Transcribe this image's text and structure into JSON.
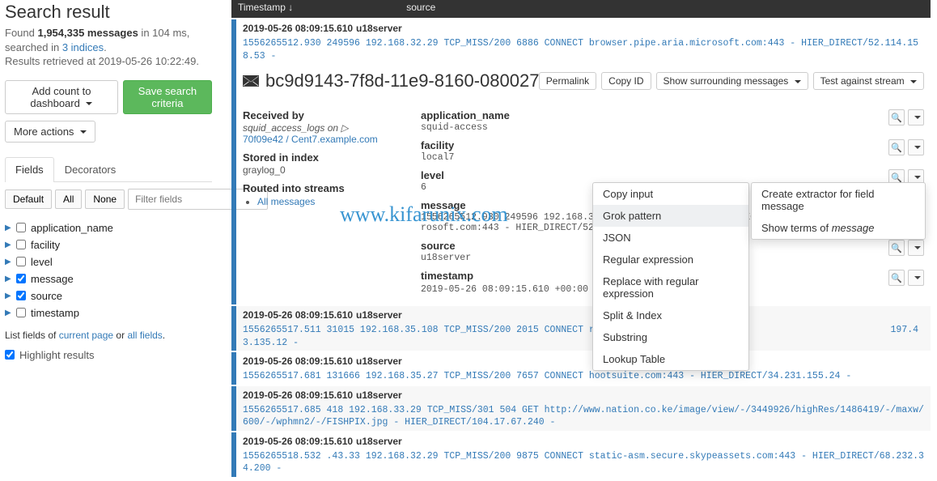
{
  "sidebar": {
    "title": "Search result",
    "found_prefix": "Found ",
    "msg_count": "1,954,335 messages",
    "found_suffix": " in 104 ms, searched in ",
    "indices_link": "3 indices",
    "retrieved": "Results retrieved at 2019-05-26 10:22:49.",
    "add_dashboard": "Add count to dashboard ",
    "save_criteria": "Save search criteria",
    "more_actions": "More actions ",
    "tab_fields": "Fields",
    "tab_decorators": "Decorators",
    "btn_default": "Default",
    "btn_all": "All",
    "btn_none": "None",
    "filter_placeholder": "Filter fields",
    "fields": [
      {
        "name": "application_name",
        "checked": false
      },
      {
        "name": "facility",
        "checked": false
      },
      {
        "name": "level",
        "checked": false
      },
      {
        "name": "message",
        "checked": true
      },
      {
        "name": "source",
        "checked": true
      },
      {
        "name": "timestamp",
        "checked": false
      }
    ],
    "listfields_prefix": "List fields of ",
    "listfields_cur": "current page",
    "listfields_or": " or ",
    "listfields_all": "all fields",
    "highlight": "Highlight results"
  },
  "tablehead": {
    "col1": "Timestamp ↓",
    "col2": "source"
  },
  "msg1": {
    "ts": "2019-05-26 08:09:15.610",
    "src": "u18server",
    "full": "1556265512.930 249596 192.168.32.29 TCP_MISS/200 6886 CONNECT browser.pipe.aria.microsoft.com:443 - HIER_DIRECT/52.114.158.53 -"
  },
  "detail": {
    "id": "bc9d9143-7f8d-11e9-8160-080027f0e1c4",
    "btn_permalink": "Permalink",
    "btn_copyid": "Copy ID",
    "btn_surrounding": "Show surrounding messages ",
    "btn_test": "Test against stream ",
    "received_lbl": "Received by",
    "received_val1": "squid_access_logs on ▷",
    "received_link": "70f09e42 / Cent7.example.com",
    "stored_lbl": "Stored in index",
    "stored_val": "graylog_0",
    "routed_lbl": "Routed into streams",
    "routed_link": "All messages",
    "fields": {
      "application_name": "squid-access",
      "facility": "local7",
      "level": "6",
      "message": "1556265512.930 249596 192.168.32.29 TCP_MISS/200 6886 CONNECT browser.pipe.aria.microsoft.com:443 - HIER_DIRECT/52.114.158.53 -",
      "source": "u18server",
      "timestamp": "2019-05-26 08:09:15.610 +00:00 ℹ"
    }
  },
  "menu_left": [
    "Copy input",
    "Grok pattern",
    "JSON",
    "Regular expression",
    "Replace with regular expression",
    "Split & Index",
    "Substring",
    "Lookup Table"
  ],
  "menu_right_1": "Create extractor for field message",
  "menu_right_2a": "Show terms of ",
  "menu_right_2b": "message",
  "rows": [
    {
      "ts": "2019-05-26 08:09:15.610",
      "src": "u18server",
      "full": "1556265517.511 31015 192.168.35.108 TCP_MISS/200 2015 CONNECT r1---sn-hfxc-wo                                       197.43.135.12 -"
    },
    {
      "ts": "2019-05-26 08:09:15.610",
      "src": "u18server",
      "full": "1556265517.681 131666 192.168.35.27 TCP_MISS/200 7657 CONNECT hootsuite.com:443 - HIER_DIRECT/34.231.155.24 -"
    },
    {
      "ts": "2019-05-26 08:09:15.610",
      "src": "u18server",
      "full": "1556265517.685 418 192.168.33.29 TCP_MISS/301 504 GET http://www.nation.co.ke/image/view/-/3449926/highRes/1486419/-/maxw/600/-/wphmn2/-/FISHPIX.jpg - HIER_DIRECT/104.17.67.240 -"
    },
    {
      "ts": "2019-05-26 08:09:15.610",
      "src": "u18server",
      "full": "1556265518.532 .43.33 192.168.32.29 TCP_MISS/200 9875 CONNECT static-asm.secure.skypeassets.com:443 - HIER_DIRECT/68.232.34.200 -"
    }
  ],
  "watermark": "www.kifarunix.com"
}
